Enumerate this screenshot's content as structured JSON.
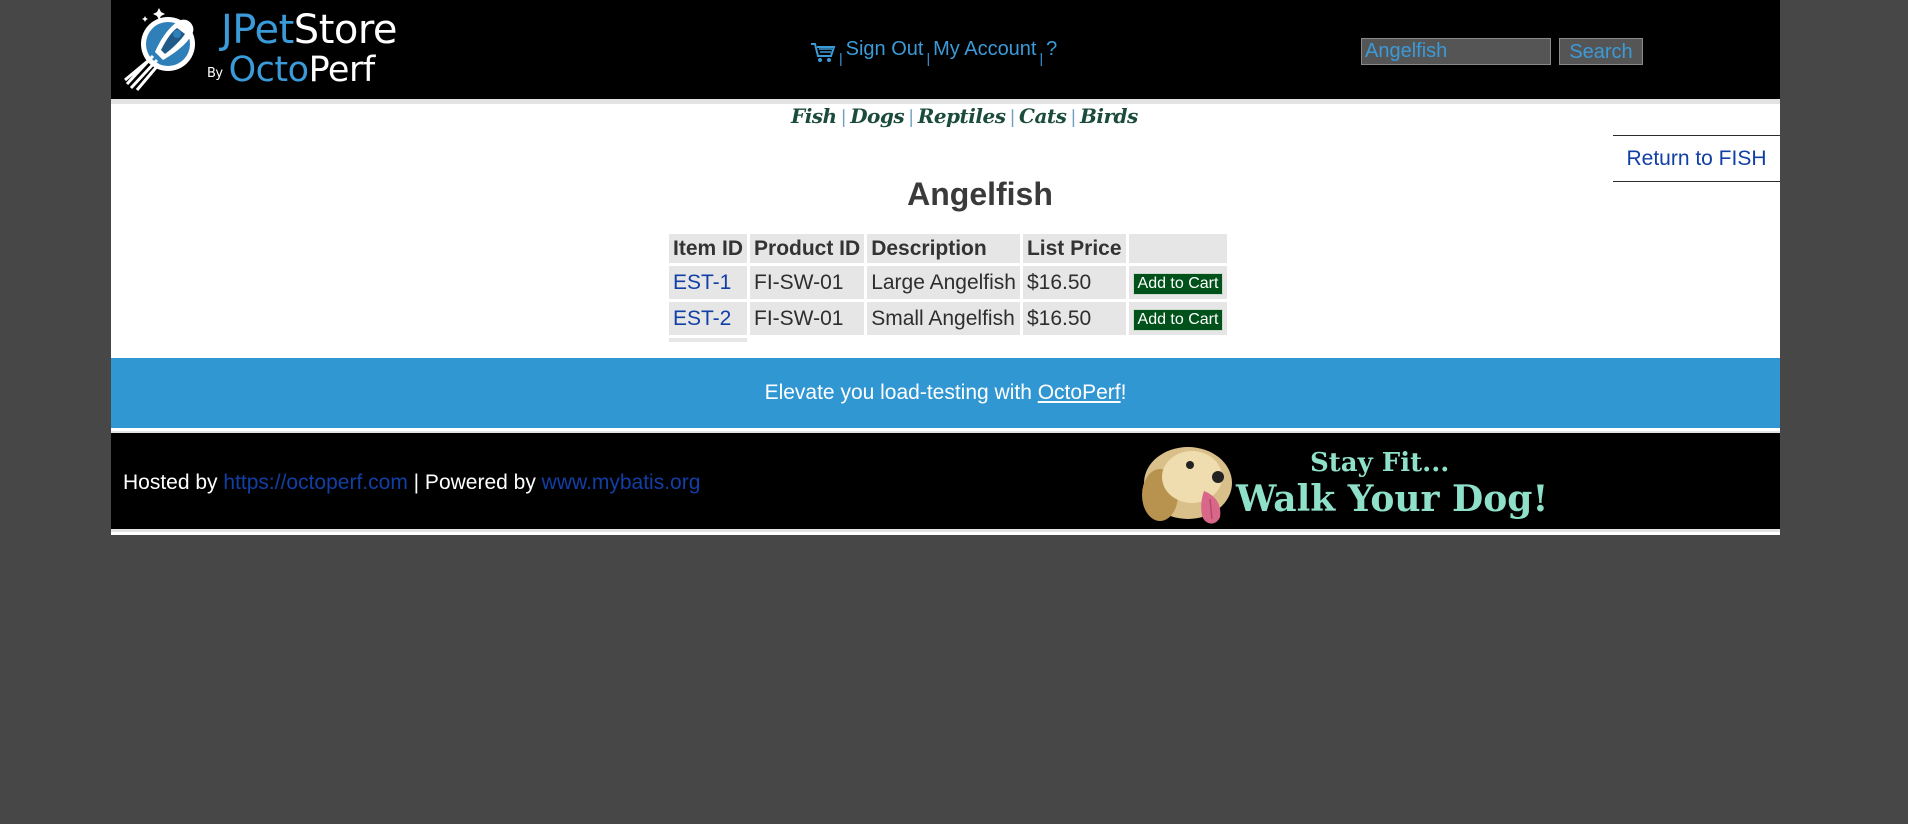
{
  "header": {
    "logo": {
      "brand_part1": "J",
      "brand_part2": "Pet",
      "brand_part3": "Store",
      "by": "By",
      "octo": "Octo",
      "perf": "Perf"
    },
    "menu": {
      "sign_out": "Sign Out",
      "my_account": "My Account",
      "help": "?",
      "separator": "|"
    },
    "search": {
      "value": "Angelfish",
      "button_label": "Search"
    }
  },
  "categories": [
    "Fish",
    "Dogs",
    "Reptiles",
    "Cats",
    "Birds"
  ],
  "return_link": "Return to FISH",
  "product": {
    "title": "Angelfish",
    "columns": [
      "Item ID",
      "Product ID",
      "Description",
      "List Price",
      ""
    ],
    "rows": [
      {
        "item_id": "EST-1",
        "product_id": "FI-SW-01",
        "description": "Large Angelfish",
        "price": "$16.50",
        "action": "Add to Cart"
      },
      {
        "item_id": "EST-2",
        "product_id": "FI-SW-01",
        "description": "Small Angelfish",
        "price": "$16.50",
        "action": "Add to Cart"
      }
    ]
  },
  "promo": {
    "prefix": "Elevate you load-testing with ",
    "link": "OctoPerf",
    "suffix": "!"
  },
  "footer": {
    "hosted_by": "Hosted by ",
    "hosted_link": "https://octoperf.com",
    "powered_by": " | Powered by ",
    "powered_link": "www.mybatis.org",
    "ad_line1": "Stay Fit...",
    "ad_line2": "Walk Your Dog!"
  },
  "colors": {
    "accent": "#3b9ad8",
    "link": "#123fa6",
    "promo_bg": "#3197d3",
    "button_bg": "#00521a"
  }
}
